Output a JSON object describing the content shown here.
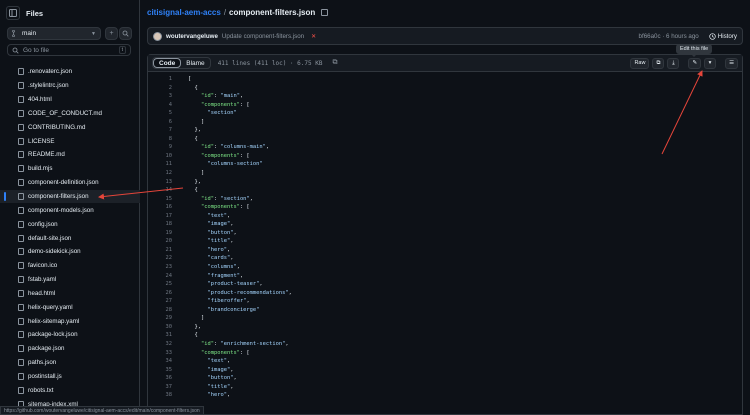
{
  "sidebar": {
    "title": "Files",
    "branch": "main",
    "goto_placeholder": "Go to file",
    "goto_shortcut": "t",
    "files": [
      ".renovaterc.json",
      ".stylelintrc.json",
      "404.html",
      "CODE_OF_CONDUCT.md",
      "CONTRIBUTING.md",
      "LICENSE",
      "README.md",
      "build.mjs",
      "component-definition.json",
      "component-filters.json",
      "component-models.json",
      "config.json",
      "default-site.json",
      "demo-sidekick.json",
      "favicon.ico",
      "fstab.yaml",
      "head.html",
      "helix-query.yaml",
      "helix-sitemap.yaml",
      "package-lock.json",
      "package.json",
      "paths.json",
      "postinstall.js",
      "robots.txt",
      "sitemap-index.xml"
    ],
    "active_file": "component-filters.json"
  },
  "breadcrumb": {
    "repo": "citisignal-aem-accs",
    "sep": "/",
    "file": "component-filters.json"
  },
  "commit": {
    "author": "woutervangeluwe",
    "message": "Update component-filters.json",
    "status": "✕",
    "hash_time": "bf66a0c · 6 hours ago",
    "history": "History"
  },
  "tooltip": "Edit this file",
  "viewer": {
    "tabs": [
      "Code",
      "Blame"
    ],
    "info": "411 lines (411 loc) · 6.75 KB",
    "raw": "Raw"
  },
  "code_lines": [
    "[",
    "  {",
    "    \"id\": \"main\",",
    "    \"components\": [",
    "      \"section\"",
    "    ]",
    "  },",
    "  {",
    "    \"id\": \"columns-main\",",
    "    \"components\": [",
    "      \"columns-section\"",
    "    ]",
    "  },",
    "  {",
    "    \"id\": \"section\",",
    "    \"components\": [",
    "      \"text\",",
    "      \"image\",",
    "      \"button\",",
    "      \"title\",",
    "      \"hero\",",
    "      \"cards\",",
    "      \"columns\",",
    "      \"fragment\",",
    "      \"product-teaser\",",
    "      \"product-recommendations\",",
    "      \"fiberoffer\",",
    "      \"brandconcierge\"",
    "    ]",
    "  },",
    "  {",
    "    \"id\": \"enrichment-section\",",
    "    \"components\": [",
    "      \"text\",",
    "      \"image\",",
    "      \"button\",",
    "      \"title\",",
    "      \"hero\","
  ],
  "status_url": "https://github.com/woutervangeluwe/citisignal-aem-accs/edit/main/component-filters.json",
  "colors": {
    "accent": "#2f81f7",
    "annotation": "#e5453a",
    "background": "#0d1117"
  }
}
